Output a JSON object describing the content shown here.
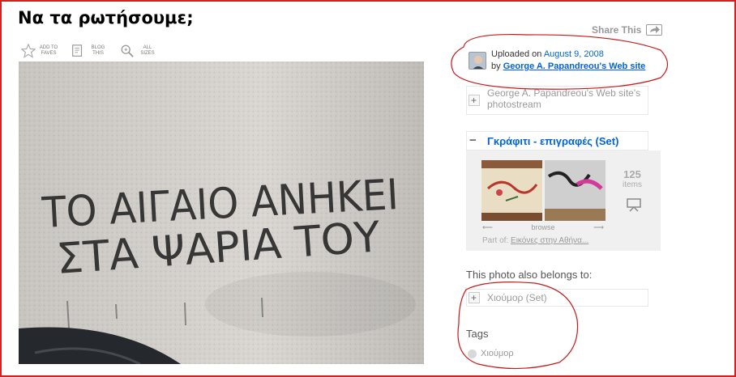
{
  "page": {
    "title": "Να τα ρωτήσουμε;"
  },
  "toolbar": {
    "items": [
      {
        "label": "ADD TO FAVES",
        "icon": "star-icon"
      },
      {
        "label": "BLOG THIS",
        "icon": "blog-icon"
      },
      {
        "label": "ALL SIZES",
        "icon": "zoom-icon"
      }
    ]
  },
  "photo": {
    "graffiti_line1": "ΤΟ ΑΙΓΑΙΟ ΑΝΗΚΕΙ",
    "graffiti_line2": "ΣΤΑ ΨΑΡΙΑ ΤΟΥ"
  },
  "share": {
    "label": "Share This"
  },
  "uploader": {
    "prefix": "Uploaded on",
    "date": "August 9, 2008",
    "by": "by",
    "owner": "George A. Papandreou's Web site"
  },
  "photostream": {
    "label": "George A. Papandreou's Web site's photostream"
  },
  "set": {
    "name": "Γκράφιτι - επιγραφές (Set)",
    "count": "125",
    "count_label": "items",
    "browse": "browse",
    "partof_prefix": "Part of:",
    "partof_link": "Εικόνες στην Αθήνα..."
  },
  "belongs": {
    "title": "This photo also belongs to:",
    "set_name": "Χιούμορ (Set)"
  },
  "tags": {
    "title": "Tags",
    "items": [
      "Χιούμορ"
    ]
  },
  "colors": {
    "link": "#0063dc",
    "annotation": "#c81818"
  }
}
